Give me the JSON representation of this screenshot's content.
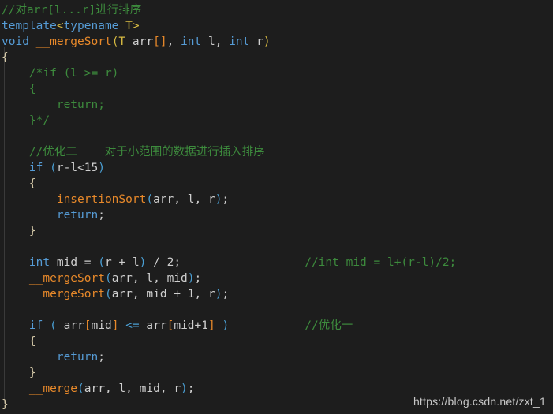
{
  "editor": {
    "background_color": "#1d1d1d",
    "language": "C++",
    "colors": {
      "comment": "#3d8b3d",
      "keyword": "#569cd6",
      "function": "#e8892a",
      "type_param": "#d7ba42",
      "brace": "#d4c8a8",
      "bracket": "#e8892a",
      "identifier": "#cfcfcf",
      "punctuation": "#4a9fd4"
    }
  },
  "code_lines": [
    {
      "id": "line-1",
      "text": "//对arr[l...r]进行排序",
      "tokens": [
        {
          "t": "//对arr[l...r]进行排序",
          "c": "cmt"
        }
      ]
    },
    {
      "id": "line-2",
      "text": "template<typename T>",
      "tokens": [
        {
          "t": "template",
          "c": "kw"
        },
        {
          "t": "<",
          "c": "typ"
        },
        {
          "t": "typename",
          "c": "kw"
        },
        {
          "t": " ",
          "c": "op"
        },
        {
          "t": "T",
          "c": "typ"
        },
        {
          "t": ">",
          "c": "typ"
        }
      ]
    },
    {
      "id": "line-3",
      "text": "void __mergeSort(T arr[], int l, int r)",
      "tokens": [
        {
          "t": "void",
          "c": "kw"
        },
        {
          "t": " ",
          "c": "op"
        },
        {
          "t": "__mergeSort",
          "c": "fn"
        },
        {
          "t": "(",
          "c": "typ"
        },
        {
          "t": "T",
          "c": "typ"
        },
        {
          "t": " ",
          "c": "op"
        },
        {
          "t": "arr",
          "c": "id"
        },
        {
          "t": "[]",
          "c": "brk"
        },
        {
          "t": ",",
          "c": "op"
        },
        {
          "t": " ",
          "c": "op"
        },
        {
          "t": "int",
          "c": "kw"
        },
        {
          "t": " ",
          "c": "op"
        },
        {
          "t": "l",
          "c": "id"
        },
        {
          "t": ",",
          "c": "op"
        },
        {
          "t": " ",
          "c": "op"
        },
        {
          "t": "int",
          "c": "kw"
        },
        {
          "t": " ",
          "c": "op"
        },
        {
          "t": "r",
          "c": "id"
        },
        {
          "t": ")",
          "c": "typ"
        }
      ]
    },
    {
      "id": "line-4",
      "text": "{",
      "tokens": [
        {
          "t": "{",
          "c": "br"
        }
      ]
    },
    {
      "id": "line-5",
      "text": "    /*if (l >= r)",
      "tokens": [
        {
          "t": "    /*if (l >= r)",
          "c": "cmt"
        }
      ]
    },
    {
      "id": "line-6",
      "text": "    {",
      "tokens": [
        {
          "t": "    {",
          "c": "cmt"
        }
      ]
    },
    {
      "id": "line-7",
      "text": "        return;",
      "tokens": [
        {
          "t": "        return;",
          "c": "cmt"
        }
      ]
    },
    {
      "id": "line-8",
      "text": "    }*/",
      "tokens": [
        {
          "t": "    }*/",
          "c": "cmt"
        }
      ]
    },
    {
      "id": "line-9",
      "text": "",
      "tokens": []
    },
    {
      "id": "line-10",
      "text": "    //优化二    对于小范围的数据进行插入排序",
      "tokens": [
        {
          "t": "    //优化二    对于小范围的数据进行插入排序",
          "c": "cmt"
        }
      ]
    },
    {
      "id": "line-11",
      "text": "    if (r-l<15)",
      "tokens": [
        {
          "t": "    ",
          "c": "op"
        },
        {
          "t": "if",
          "c": "kw"
        },
        {
          "t": " ",
          "c": "op"
        },
        {
          "t": "(",
          "c": "pun"
        },
        {
          "t": "r",
          "c": "id"
        },
        {
          "t": "-",
          "c": "op"
        },
        {
          "t": "l",
          "c": "id"
        },
        {
          "t": "<",
          "c": "op"
        },
        {
          "t": "15",
          "c": "num"
        },
        {
          "t": ")",
          "c": "pun"
        }
      ]
    },
    {
      "id": "line-12",
      "text": "    {",
      "tokens": [
        {
          "t": "    ",
          "c": "op"
        },
        {
          "t": "{",
          "c": "br"
        }
      ]
    },
    {
      "id": "line-13",
      "text": "        insertionSort(arr, l, r);",
      "tokens": [
        {
          "t": "        ",
          "c": "op"
        },
        {
          "t": "insertionSort",
          "c": "fn"
        },
        {
          "t": "(",
          "c": "pun"
        },
        {
          "t": "arr",
          "c": "id"
        },
        {
          "t": ",",
          "c": "op"
        },
        {
          "t": " ",
          "c": "op"
        },
        {
          "t": "l",
          "c": "id"
        },
        {
          "t": ",",
          "c": "op"
        },
        {
          "t": " ",
          "c": "op"
        },
        {
          "t": "r",
          "c": "id"
        },
        {
          "t": ")",
          "c": "pun"
        },
        {
          "t": ";",
          "c": "op"
        }
      ]
    },
    {
      "id": "line-14",
      "text": "        return;",
      "tokens": [
        {
          "t": "        ",
          "c": "op"
        },
        {
          "t": "return",
          "c": "kw"
        },
        {
          "t": ";",
          "c": "op"
        }
      ]
    },
    {
      "id": "line-15",
      "text": "    }",
      "tokens": [
        {
          "t": "    ",
          "c": "op"
        },
        {
          "t": "}",
          "c": "br"
        }
      ]
    },
    {
      "id": "line-16",
      "text": "",
      "tokens": []
    },
    {
      "id": "line-17",
      "text": "    int mid = (r + l) / 2;                  //int mid = l+(r-l)/2;",
      "tokens": [
        {
          "t": "    ",
          "c": "op"
        },
        {
          "t": "int",
          "c": "kw"
        },
        {
          "t": " ",
          "c": "op"
        },
        {
          "t": "mid",
          "c": "id"
        },
        {
          "t": " = ",
          "c": "op"
        },
        {
          "t": "(",
          "c": "pun"
        },
        {
          "t": "r",
          "c": "id"
        },
        {
          "t": " + ",
          "c": "op"
        },
        {
          "t": "l",
          "c": "id"
        },
        {
          "t": ")",
          "c": "pun"
        },
        {
          "t": " / ",
          "c": "op"
        },
        {
          "t": "2",
          "c": "num"
        },
        {
          "t": ";",
          "c": "op"
        },
        {
          "t": "                  ",
          "c": "op"
        },
        {
          "t": "//int mid = l+(r-l)/2;",
          "c": "cmt"
        }
      ]
    },
    {
      "id": "line-18",
      "text": "    __mergeSort(arr, l, mid);",
      "tokens": [
        {
          "t": "    ",
          "c": "op"
        },
        {
          "t": "__mergeSort",
          "c": "fn"
        },
        {
          "t": "(",
          "c": "pun"
        },
        {
          "t": "arr",
          "c": "id"
        },
        {
          "t": ",",
          "c": "op"
        },
        {
          "t": " ",
          "c": "op"
        },
        {
          "t": "l",
          "c": "id"
        },
        {
          "t": ",",
          "c": "op"
        },
        {
          "t": " ",
          "c": "op"
        },
        {
          "t": "mid",
          "c": "id"
        },
        {
          "t": ")",
          "c": "pun"
        },
        {
          "t": ";",
          "c": "op"
        }
      ]
    },
    {
      "id": "line-19",
      "text": "    __mergeSort(arr, mid + 1, r);",
      "tokens": [
        {
          "t": "    ",
          "c": "op"
        },
        {
          "t": "__mergeSort",
          "c": "fn"
        },
        {
          "t": "(",
          "c": "pun"
        },
        {
          "t": "arr",
          "c": "id"
        },
        {
          "t": ",",
          "c": "op"
        },
        {
          "t": " ",
          "c": "op"
        },
        {
          "t": "mid",
          "c": "id"
        },
        {
          "t": " + ",
          "c": "op"
        },
        {
          "t": "1",
          "c": "num"
        },
        {
          "t": ",",
          "c": "op"
        },
        {
          "t": " ",
          "c": "op"
        },
        {
          "t": "r",
          "c": "id"
        },
        {
          "t": ")",
          "c": "pun"
        },
        {
          "t": ";",
          "c": "op"
        }
      ]
    },
    {
      "id": "line-20",
      "text": "",
      "tokens": []
    },
    {
      "id": "line-21",
      "text": "    if ( arr[mid] <= arr[mid+1] )           //优化一",
      "tokens": [
        {
          "t": "    ",
          "c": "op"
        },
        {
          "t": "if",
          "c": "kw"
        },
        {
          "t": " ",
          "c": "op"
        },
        {
          "t": "(",
          "c": "pun"
        },
        {
          "t": " ",
          "c": "op"
        },
        {
          "t": "arr",
          "c": "id"
        },
        {
          "t": "[",
          "c": "brk"
        },
        {
          "t": "mid",
          "c": "id"
        },
        {
          "t": "]",
          "c": "brk"
        },
        {
          "t": " ",
          "c": "op"
        },
        {
          "t": "<=",
          "c": "pun"
        },
        {
          "t": " ",
          "c": "op"
        },
        {
          "t": "arr",
          "c": "id"
        },
        {
          "t": "[",
          "c": "brk"
        },
        {
          "t": "mid",
          "c": "id"
        },
        {
          "t": "+",
          "c": "op"
        },
        {
          "t": "1",
          "c": "num"
        },
        {
          "t": "]",
          "c": "brk"
        },
        {
          "t": " ",
          "c": "op"
        },
        {
          "t": ")",
          "c": "pun"
        },
        {
          "t": "           ",
          "c": "op"
        },
        {
          "t": "//优化一",
          "c": "cmt"
        }
      ]
    },
    {
      "id": "line-22",
      "text": "    {",
      "tokens": [
        {
          "t": "    ",
          "c": "op"
        },
        {
          "t": "{",
          "c": "br"
        }
      ]
    },
    {
      "id": "line-23",
      "text": "        return;",
      "tokens": [
        {
          "t": "        ",
          "c": "op"
        },
        {
          "t": "return",
          "c": "kw"
        },
        {
          "t": ";",
          "c": "op"
        }
      ]
    },
    {
      "id": "line-24",
      "text": "    }",
      "tokens": [
        {
          "t": "    ",
          "c": "op"
        },
        {
          "t": "}",
          "c": "br"
        }
      ]
    },
    {
      "id": "line-25",
      "text": "    __merge(arr, l, mid, r);",
      "tokens": [
        {
          "t": "    ",
          "c": "op"
        },
        {
          "t": "__merge",
          "c": "fn"
        },
        {
          "t": "(",
          "c": "pun"
        },
        {
          "t": "arr",
          "c": "id"
        },
        {
          "t": ",",
          "c": "op"
        },
        {
          "t": " ",
          "c": "op"
        },
        {
          "t": "l",
          "c": "id"
        },
        {
          "t": ",",
          "c": "op"
        },
        {
          "t": " ",
          "c": "op"
        },
        {
          "t": "mid",
          "c": "id"
        },
        {
          "t": ",",
          "c": "op"
        },
        {
          "t": " ",
          "c": "op"
        },
        {
          "t": "r",
          "c": "id"
        },
        {
          "t": ")",
          "c": "pun"
        },
        {
          "t": ";",
          "c": "op"
        }
      ]
    },
    {
      "id": "line-26",
      "text": "}",
      "tokens": [
        {
          "t": "}",
          "c": "br"
        }
      ]
    }
  ],
  "watermark": {
    "text": "https://blog.csdn.net/zxt_1"
  }
}
